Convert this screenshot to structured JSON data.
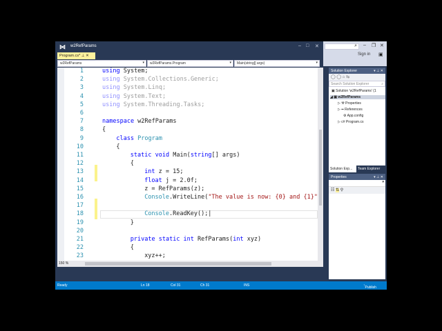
{
  "window": {
    "title": "w2RefParams",
    "sign_in": "Sign in"
  },
  "tab": {
    "label": "Program.cs*"
  },
  "nav": {
    "project": "w2RefParams",
    "class": "w2RefParams.Program",
    "member": "Main(string[] args)"
  },
  "editor": {
    "zoom": "150 %",
    "line_numbers": [
      "1",
      "2",
      "3",
      "4",
      "5",
      "6",
      "7",
      "8",
      "9",
      "10",
      "11",
      "12",
      "13",
      "14",
      "15",
      "16",
      "17",
      "18",
      "19",
      "20",
      "21",
      "22",
      "23"
    ]
  },
  "solution_explorer": {
    "title": "Solution Explorer",
    "search_placeholder": "Search Solution Explorer",
    "solution": "Solution 'w2RefParams' (1",
    "project": "w2RefParams",
    "items": [
      "Properties",
      "References",
      "App.config",
      "Program.cs"
    ],
    "tabs": [
      "Solution Exp...",
      "Team Explorer"
    ]
  },
  "properties": {
    "title": "Properties"
  },
  "status": {
    "ready": "Ready",
    "ln": "Ln 18",
    "col": "Col 31",
    "ch": "Ch 31",
    "mode": "INS",
    "publish": "Publish"
  }
}
